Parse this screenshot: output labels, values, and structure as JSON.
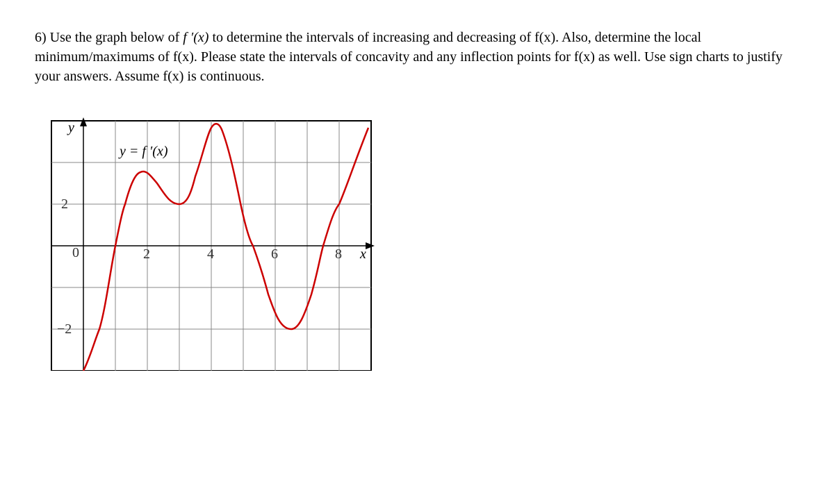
{
  "problem": {
    "number": "6)",
    "text_part1": "Use the graph below of ",
    "fprime": "f ′(x)",
    "text_part2": " to determine the intervals of increasing and decreasing of f(x).  Also, determine the local minimum/maximums of f(x).   Please state the intervals of concavity and any inflection points for f(x) as well.  Use sign charts to justify your answers.  Assume f(x) is continuous."
  },
  "chart_data": {
    "type": "line",
    "title": "",
    "curve_label": "y = f ′(x)",
    "xlabel": "x",
    "ylabel": "y",
    "xlim": [
      -1,
      9
    ],
    "ylim": [
      -3,
      3
    ],
    "x_ticks": [
      0,
      2,
      4,
      6,
      8
    ],
    "y_ticks": [
      -2,
      0,
      2
    ],
    "series": [
      {
        "name": "f'(x)",
        "x": [
          0.0,
          0.5,
          1.0,
          1.3,
          1.7,
          2.0,
          2.3,
          2.7,
          3.0,
          3.5,
          4.0,
          4.3,
          4.7,
          5.0,
          5.3,
          5.7,
          6.0,
          6.5,
          7.0,
          7.5,
          8.0,
          8.5,
          9.0
        ],
        "y": [
          -3.0,
          -2.0,
          0.0,
          1.0,
          1.7,
          1.8,
          1.5,
          1.0,
          1.0,
          2.0,
          2.8,
          3.0,
          2.3,
          1.1,
          0.0,
          -1.0,
          -1.6,
          -2.0,
          -1.5,
          0.0,
          1.0,
          2.0,
          2.8
        ]
      }
    ]
  },
  "labels": {
    "y_axis": "y",
    "x_axis": "x",
    "tick0": "0",
    "tick2": "2",
    "tick4": "4",
    "tick6": "6",
    "tick8": "8",
    "tickn2": "−2",
    "tickp2": "2"
  }
}
